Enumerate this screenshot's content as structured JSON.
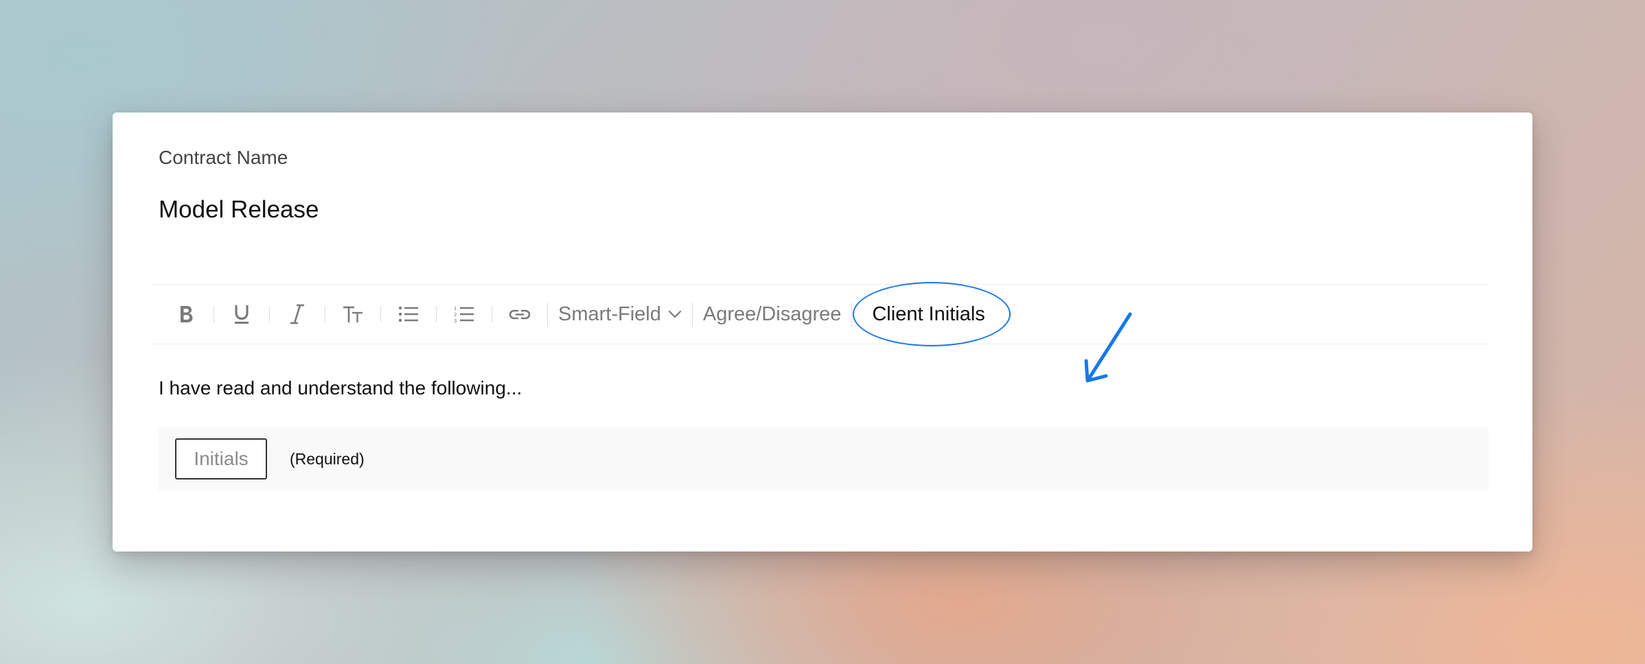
{
  "form": {
    "field_label": "Contract Name",
    "contract_name": "Model Release"
  },
  "toolbar": {
    "buttons": [
      {
        "name": "bold",
        "icon": "bold-icon"
      },
      {
        "name": "underline",
        "icon": "underline-icon"
      },
      {
        "name": "italic",
        "icon": "italic-icon"
      },
      {
        "name": "text-size",
        "icon": "text-size-icon"
      },
      {
        "name": "bullet-list",
        "icon": "bullet-list-icon"
      },
      {
        "name": "numbered-list",
        "icon": "numbered-list-icon"
      },
      {
        "name": "link",
        "icon": "link-icon"
      }
    ],
    "smart_field_label": "Smart-Field",
    "agree_disagree_label": "Agree/Disagree",
    "client_initials_label": "Client Initials"
  },
  "content": {
    "body_text": "I have read and understand the following...",
    "initials_placeholder": "Initials",
    "required_label": "(Required)"
  },
  "colors": {
    "annotation": "#1877e8",
    "icon_gray": "#7a7a7a",
    "text": "#111111"
  }
}
